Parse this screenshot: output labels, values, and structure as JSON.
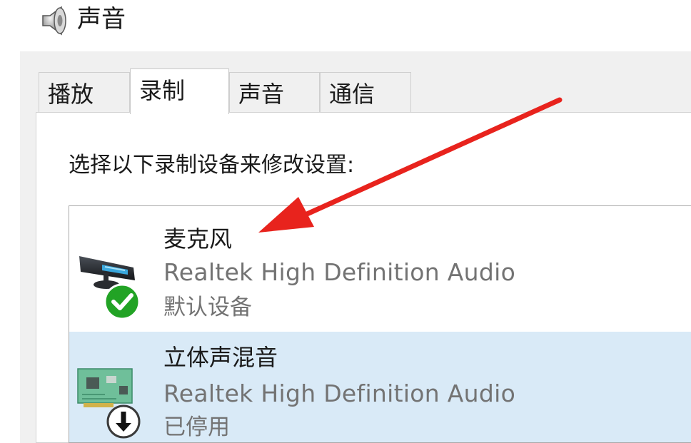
{
  "window": {
    "title": "声音",
    "icon": "speaker-icon"
  },
  "tabs": [
    {
      "label": "播放",
      "selected": false
    },
    {
      "label": "录制",
      "selected": true
    },
    {
      "label": "声音",
      "selected": false
    },
    {
      "label": "通信",
      "selected": false
    }
  ],
  "instruction": "选择以下录制设备来修改设置:",
  "devices": [
    {
      "name": "麦克风",
      "driver": "Realtek High Definition Audio",
      "status": "默认设备",
      "icon": "microphone-icon",
      "badge": "default-checkmark-icon",
      "selected": false
    },
    {
      "name": "立体声混音",
      "driver": "Realtek High Definition Audio",
      "status": "已停用",
      "icon": "sound-card-icon",
      "badge": "disabled-arrow-icon",
      "selected": true
    }
  ],
  "annotation": {
    "type": "red-arrow-icon",
    "color": "#e8231d",
    "points_to": "麦克风"
  },
  "colors": {
    "selected_row": "#d9eaf7",
    "default_badge": "#22a325",
    "secondary_text": "#737373"
  }
}
